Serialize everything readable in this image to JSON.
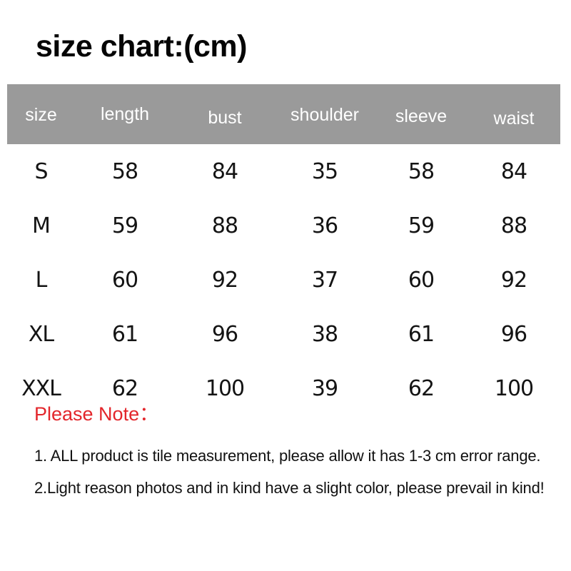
{
  "title": "size chart:(cm)",
  "table": {
    "headers": [
      "size",
      "length",
      "bust",
      "shoulder",
      "sleeve",
      "waist"
    ],
    "rows": [
      {
        "size": "S",
        "length": "58",
        "bust": "84",
        "shoulder": "35",
        "sleeve": "58",
        "waist": "84"
      },
      {
        "size": "M",
        "length": "59",
        "bust": "88",
        "shoulder": "36",
        "sleeve": "59",
        "waist": "88"
      },
      {
        "size": "L",
        "length": "60",
        "bust": "92",
        "shoulder": "37",
        "sleeve": "60",
        "waist": "92"
      },
      {
        "size": "XL",
        "length": "61",
        "bust": "96",
        "shoulder": "38",
        "sleeve": "61",
        "waist": "96"
      },
      {
        "size": "XXL",
        "length": "62",
        "bust": "100",
        "shoulder": "39",
        "sleeve": "62",
        "waist": "100"
      }
    ],
    "header_background": "#9a9a9a",
    "header_text_color": "#ffffff"
  },
  "notes": {
    "heading": "Please Note：",
    "heading_color": "#e3262b",
    "items": [
      "1. ALL product is tile measurement, please allow it has 1-3 cm error range.",
      "2.Light reason photos and in kind have a slight color, please prevail in kind!"
    ]
  }
}
